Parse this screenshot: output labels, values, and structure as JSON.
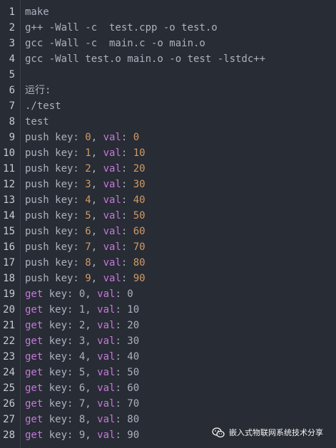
{
  "lines": [
    {
      "n": "1",
      "segs": [
        {
          "t": "make",
          "c": "plain"
        }
      ]
    },
    {
      "n": "2",
      "segs": [
        {
          "t": "g++ -Wall -c  test.cpp -o test.o",
          "c": "plain"
        }
      ]
    },
    {
      "n": "3",
      "segs": [
        {
          "t": "gcc -Wall -c  main.c -o main.o",
          "c": "plain"
        }
      ]
    },
    {
      "n": "4",
      "segs": [
        {
          "t": "gcc -Wall test.o main.o -o test -lstdc++",
          "c": "plain"
        }
      ]
    },
    {
      "n": "5",
      "segs": []
    },
    {
      "n": "6",
      "segs": [
        {
          "t": "运行:",
          "c": "plain"
        }
      ]
    },
    {
      "n": "7",
      "segs": [
        {
          "t": "./test",
          "c": "plain"
        }
      ]
    },
    {
      "n": "8",
      "segs": [
        {
          "t": "test",
          "c": "plain"
        }
      ]
    },
    {
      "n": "9",
      "segs": [
        {
          "t": "push key: ",
          "c": "plain"
        },
        {
          "t": "0",
          "c": "num"
        },
        {
          "t": ", ",
          "c": "plain"
        },
        {
          "t": "val",
          "c": "kw"
        },
        {
          "t": ": ",
          "c": "plain"
        },
        {
          "t": "0",
          "c": "num"
        }
      ]
    },
    {
      "n": "10",
      "segs": [
        {
          "t": "push key: ",
          "c": "plain"
        },
        {
          "t": "1",
          "c": "num"
        },
        {
          "t": ", ",
          "c": "plain"
        },
        {
          "t": "val",
          "c": "kw"
        },
        {
          "t": ": ",
          "c": "plain"
        },
        {
          "t": "10",
          "c": "num"
        }
      ]
    },
    {
      "n": "11",
      "segs": [
        {
          "t": "push key: ",
          "c": "plain"
        },
        {
          "t": "2",
          "c": "num"
        },
        {
          "t": ", ",
          "c": "plain"
        },
        {
          "t": "val",
          "c": "kw"
        },
        {
          "t": ": ",
          "c": "plain"
        },
        {
          "t": "20",
          "c": "num"
        }
      ]
    },
    {
      "n": "12",
      "segs": [
        {
          "t": "push key: ",
          "c": "plain"
        },
        {
          "t": "3",
          "c": "num"
        },
        {
          "t": ", ",
          "c": "plain"
        },
        {
          "t": "val",
          "c": "kw"
        },
        {
          "t": ": ",
          "c": "plain"
        },
        {
          "t": "30",
          "c": "num"
        }
      ]
    },
    {
      "n": "13",
      "segs": [
        {
          "t": "push key: ",
          "c": "plain"
        },
        {
          "t": "4",
          "c": "num"
        },
        {
          "t": ", ",
          "c": "plain"
        },
        {
          "t": "val",
          "c": "kw"
        },
        {
          "t": ": ",
          "c": "plain"
        },
        {
          "t": "40",
          "c": "num"
        }
      ]
    },
    {
      "n": "14",
      "segs": [
        {
          "t": "push key: ",
          "c": "plain"
        },
        {
          "t": "5",
          "c": "num"
        },
        {
          "t": ", ",
          "c": "plain"
        },
        {
          "t": "val",
          "c": "kw"
        },
        {
          "t": ": ",
          "c": "plain"
        },
        {
          "t": "50",
          "c": "num"
        }
      ]
    },
    {
      "n": "15",
      "segs": [
        {
          "t": "push key: ",
          "c": "plain"
        },
        {
          "t": "6",
          "c": "num"
        },
        {
          "t": ", ",
          "c": "plain"
        },
        {
          "t": "val",
          "c": "kw"
        },
        {
          "t": ": ",
          "c": "plain"
        },
        {
          "t": "60",
          "c": "num"
        }
      ]
    },
    {
      "n": "16",
      "segs": [
        {
          "t": "push key: ",
          "c": "plain"
        },
        {
          "t": "7",
          "c": "num"
        },
        {
          "t": ", ",
          "c": "plain"
        },
        {
          "t": "val",
          "c": "kw"
        },
        {
          "t": ": ",
          "c": "plain"
        },
        {
          "t": "70",
          "c": "num"
        }
      ]
    },
    {
      "n": "17",
      "segs": [
        {
          "t": "push key: ",
          "c": "plain"
        },
        {
          "t": "8",
          "c": "num"
        },
        {
          "t": ", ",
          "c": "plain"
        },
        {
          "t": "val",
          "c": "kw"
        },
        {
          "t": ": ",
          "c": "plain"
        },
        {
          "t": "80",
          "c": "num"
        }
      ]
    },
    {
      "n": "18",
      "segs": [
        {
          "t": "push key: ",
          "c": "plain"
        },
        {
          "t": "9",
          "c": "num"
        },
        {
          "t": ", ",
          "c": "plain"
        },
        {
          "t": "val",
          "c": "kw"
        },
        {
          "t": ": ",
          "c": "plain"
        },
        {
          "t": "90",
          "c": "num"
        }
      ]
    },
    {
      "n": "19",
      "segs": [
        {
          "t": "get",
          "c": "kw"
        },
        {
          "t": " key: 0, ",
          "c": "plain"
        },
        {
          "t": "val",
          "c": "kw"
        },
        {
          "t": ": 0",
          "c": "plain"
        }
      ]
    },
    {
      "n": "20",
      "segs": [
        {
          "t": "get",
          "c": "kw"
        },
        {
          "t": " key: 1, ",
          "c": "plain"
        },
        {
          "t": "val",
          "c": "kw"
        },
        {
          "t": ": 10",
          "c": "plain"
        }
      ]
    },
    {
      "n": "21",
      "segs": [
        {
          "t": "get",
          "c": "kw"
        },
        {
          "t": " key: 2, ",
          "c": "plain"
        },
        {
          "t": "val",
          "c": "kw"
        },
        {
          "t": ": 20",
          "c": "plain"
        }
      ]
    },
    {
      "n": "22",
      "segs": [
        {
          "t": "get",
          "c": "kw"
        },
        {
          "t": " key: 3, ",
          "c": "plain"
        },
        {
          "t": "val",
          "c": "kw"
        },
        {
          "t": ": 30",
          "c": "plain"
        }
      ]
    },
    {
      "n": "23",
      "segs": [
        {
          "t": "get",
          "c": "kw"
        },
        {
          "t": " key: 4, ",
          "c": "plain"
        },
        {
          "t": "val",
          "c": "kw"
        },
        {
          "t": ": 40",
          "c": "plain"
        }
      ]
    },
    {
      "n": "24",
      "segs": [
        {
          "t": "get",
          "c": "kw"
        },
        {
          "t": " key: 5, ",
          "c": "plain"
        },
        {
          "t": "val",
          "c": "kw"
        },
        {
          "t": ": 50",
          "c": "plain"
        }
      ]
    },
    {
      "n": "25",
      "segs": [
        {
          "t": "get",
          "c": "kw"
        },
        {
          "t": " key: 6, ",
          "c": "plain"
        },
        {
          "t": "val",
          "c": "kw"
        },
        {
          "t": ": 60",
          "c": "plain"
        }
      ]
    },
    {
      "n": "26",
      "segs": [
        {
          "t": "get",
          "c": "kw"
        },
        {
          "t": " key: 7, ",
          "c": "plain"
        },
        {
          "t": "val",
          "c": "kw"
        },
        {
          "t": ": 70",
          "c": "plain"
        }
      ]
    },
    {
      "n": "27",
      "segs": [
        {
          "t": "get",
          "c": "kw"
        },
        {
          "t": " key: 8, ",
          "c": "plain"
        },
        {
          "t": "val",
          "c": "kw"
        },
        {
          "t": ": 80",
          "c": "plain"
        }
      ]
    },
    {
      "n": "28",
      "segs": [
        {
          "t": "get",
          "c": "kw"
        },
        {
          "t": " key: 9, ",
          "c": "plain"
        },
        {
          "t": "val",
          "c": "kw"
        },
        {
          "t": ": 90",
          "c": "plain"
        }
      ]
    }
  ],
  "watermark": {
    "icon": "wechat-icon",
    "text": "嵌入式物联网系统技术分享"
  },
  "colors": {
    "background": "#282c34",
    "plain_text": "#abb2bf",
    "line_number": "#c8ccd4",
    "keyword": "#c678dd",
    "number": "#d19a66"
  }
}
